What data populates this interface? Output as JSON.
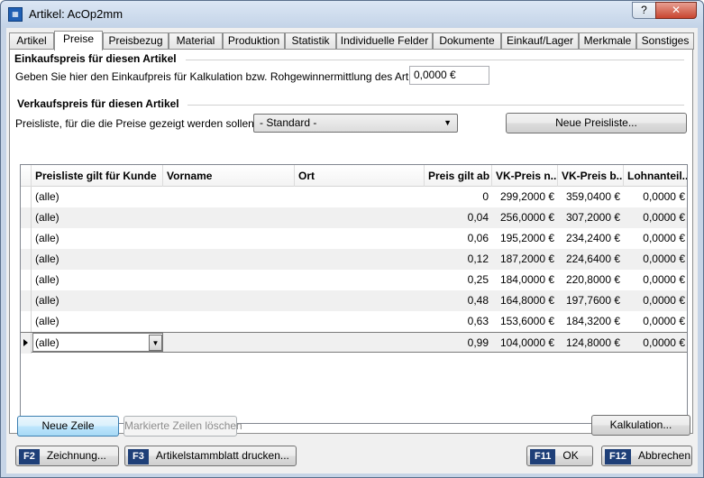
{
  "window": {
    "title": "Artikel: AcOp2mm",
    "help_label": "?",
    "close_label": "✕",
    "app_icon": "app-icon"
  },
  "tabs": [
    "Artikel",
    "Preise",
    "Preisbezug",
    "Material",
    "Produktion",
    "Statistik",
    "Individuelle Felder",
    "Dokumente",
    "Einkauf/Lager",
    "Merkmale",
    "Sonstiges"
  ],
  "active_tab": "Preise",
  "einkauf": {
    "title": "Einkaufspreis für diesen Artikel",
    "prompt": "Geben Sie hier den Einkaufpreis für Kalkulation bzw. Rohgewinnermittlung des Artikels ein:",
    "value": "0,0000 €"
  },
  "verkauf": {
    "title": "Verkaufspreis für diesen Artikel",
    "preisliste_label": "Preisliste, für die die Preise gezeigt werden sollen:",
    "preisliste_value": "- Standard -",
    "new_list_button": "Neue Preisliste..."
  },
  "grid": {
    "columns": [
      "Preisliste gilt für Kunde",
      "Vorname",
      "Ort",
      "Preis gilt ab",
      "VK-Preis n...",
      "VK-Preis b...",
      "Lohnanteil..."
    ],
    "rows": [
      [
        "(alle)",
        "",
        "",
        "0",
        "299,2000 €",
        "359,0400 €",
        "0,0000 €"
      ],
      [
        "(alle)",
        "",
        "",
        "0,04",
        "256,0000 €",
        "307,2000 €",
        "0,0000 €"
      ],
      [
        "(alle)",
        "",
        "",
        "0,06",
        "195,2000 €",
        "234,2400 €",
        "0,0000 €"
      ],
      [
        "(alle)",
        "",
        "",
        "0,12",
        "187,2000 €",
        "224,6400 €",
        "0,0000 €"
      ],
      [
        "(alle)",
        "",
        "",
        "0,25",
        "184,0000 €",
        "220,8000 €",
        "0,0000 €"
      ],
      [
        "(alle)",
        "",
        "",
        "0,48",
        "164,8000 €",
        "197,7600 €",
        "0,0000 €"
      ],
      [
        "(alle)",
        "",
        "",
        "0,63",
        "153,6000 €",
        "184,3200 €",
        "0,0000 €"
      ],
      [
        "(alle)",
        "",
        "",
        "0,99",
        "104,0000 €",
        "124,8000 €",
        "0,0000 €"
      ]
    ],
    "current_row": 7
  },
  "buttons": {
    "new_row": "Neue Zeile",
    "delete_rows": "Markierte Zeilen löschen",
    "calculation": "Kalkulation...",
    "drawing_key": "F2",
    "drawing": "Zeichnung...",
    "print_key": "F3",
    "print": "Artikelstammblatt drucken...",
    "ok_key": "F11",
    "ok": "OK",
    "cancel_key": "F12",
    "cancel": "Abbrechen"
  }
}
